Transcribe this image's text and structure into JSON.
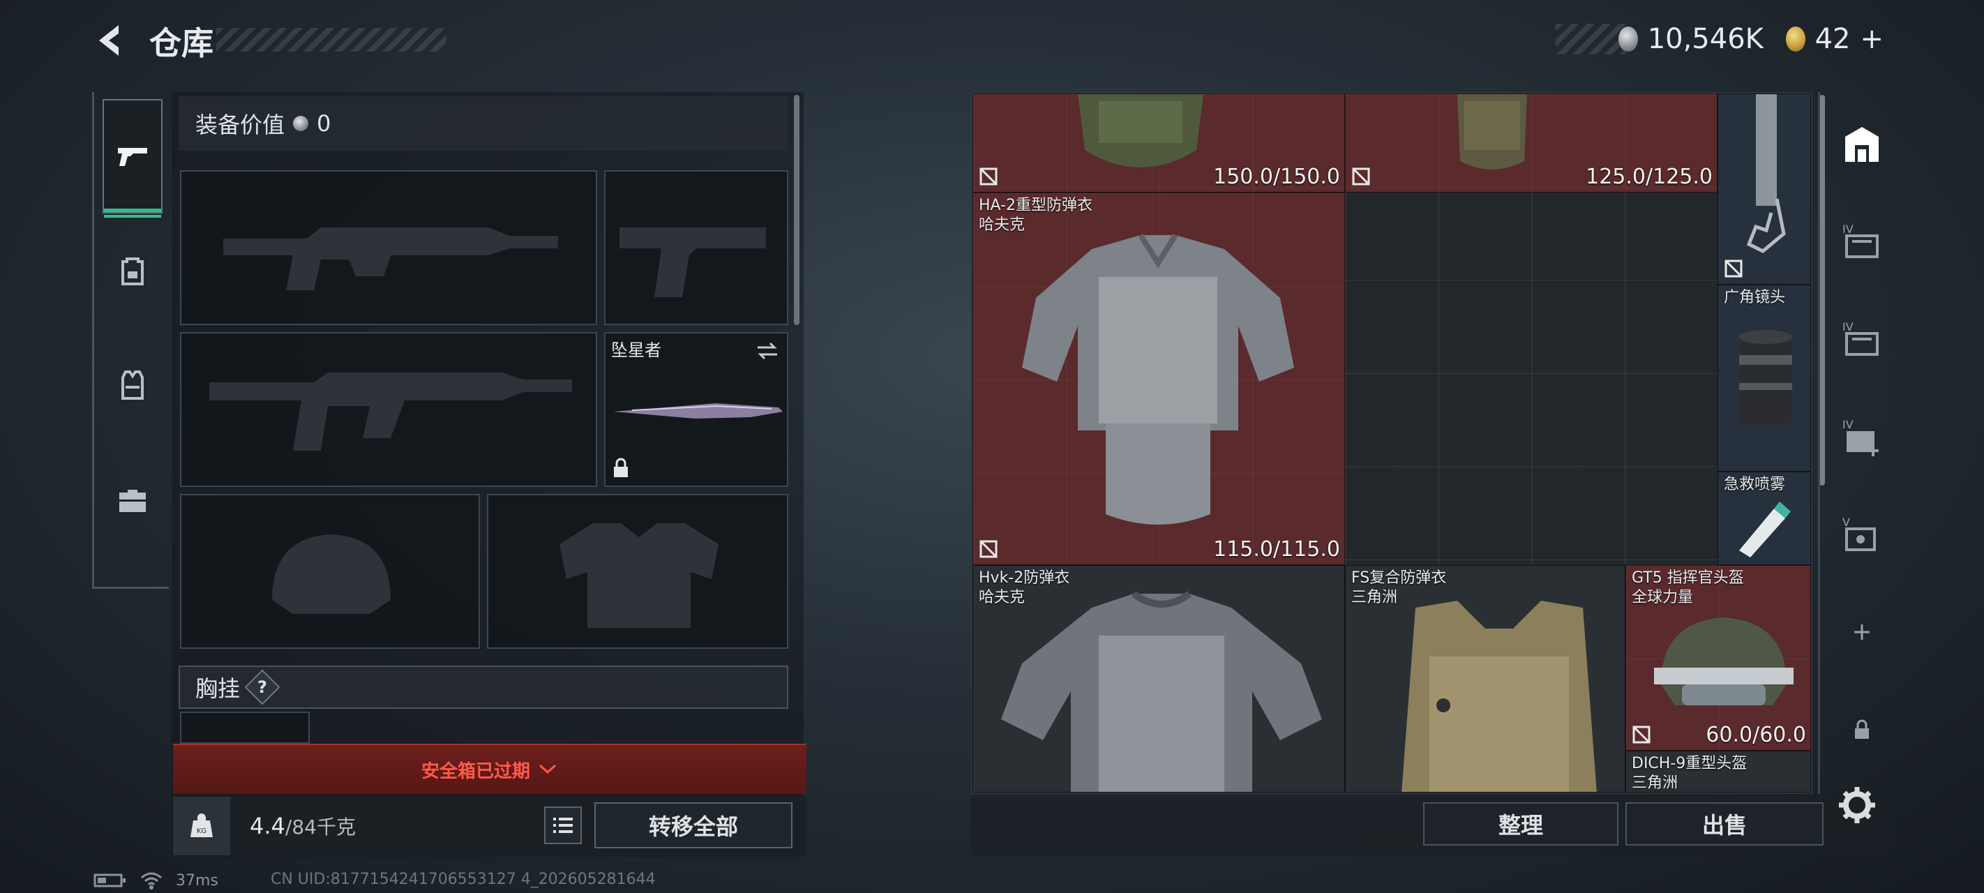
{
  "header": {
    "title": "仓库",
    "silver_amount": "10,546K",
    "gold_amount": "42",
    "plus": "+"
  },
  "equipment": {
    "value_label": "装备价值",
    "value_amount": "0",
    "melee_name": "坠星者",
    "chest_label": "胸挂",
    "chest_help": "?",
    "safebox_text": "安全箱已过期",
    "weight_current": "4.4",
    "weight_max": "/84千克",
    "transfer_all": "转移全部"
  },
  "warehouse": {
    "items": [
      {
        "name": "",
        "sub": "",
        "durability": "150.0/150.0"
      },
      {
        "name": "",
        "sub": "",
        "durability": "125.0/125.0"
      },
      {
        "name": "HA-2重型防弹衣",
        "sub": "哈夫克",
        "durability": "115.0/115.0"
      },
      {
        "name": "广角镜头",
        "sub": "",
        "durability": ""
      },
      {
        "name": "急救喷雾",
        "sub": "",
        "durability": ""
      },
      {
        "name": "Hvk-2防弹衣",
        "sub": "哈夫克",
        "durability": ""
      },
      {
        "name": "FS复合防弹衣",
        "sub": "三角洲",
        "durability": ""
      },
      {
        "name": "GT5 指挥官头盔",
        "sub": "全球力量",
        "durability": "60.0/60.0"
      },
      {
        "name": "DICH-9重型头盔",
        "sub": "三角洲",
        "durability": ""
      }
    ],
    "sort_label": "整理",
    "sell_label": "出售"
  },
  "right_tabs": [
    "IV",
    "IV",
    "IV",
    "V"
  ],
  "status": {
    "ping": "37ms",
    "uid": "CN UID:8177154241706553127 4_202605281644"
  }
}
